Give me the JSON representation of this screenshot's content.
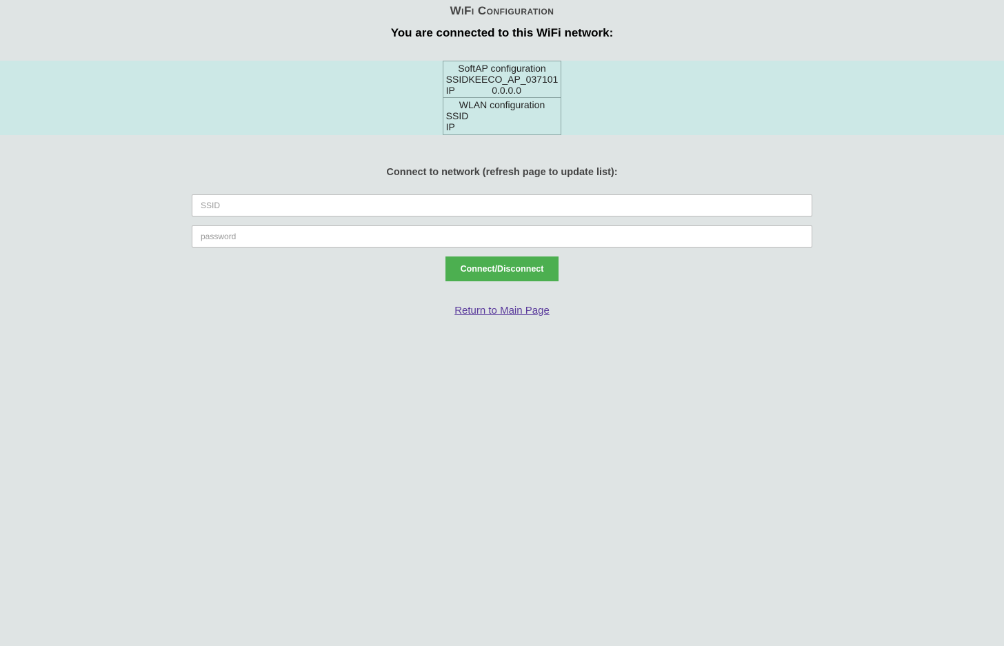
{
  "header": {
    "title": "WiFi Configuration",
    "connected_label": "You are connected to this WiFi network:"
  },
  "info": {
    "softap": {
      "title": "SoftAP configuration",
      "ssid_label": "SSID",
      "ssid_value": "KEECO_AP_037101",
      "ip_label": "IP",
      "ip_value": "0.0.0.0"
    },
    "wlan": {
      "title": "WLAN configuration",
      "ssid_label": "SSID",
      "ssid_value": "",
      "ip_label": "IP",
      "ip_value": ""
    }
  },
  "form": {
    "heading": "Connect to network (refresh page to update list):",
    "ssid_placeholder": "SSID",
    "ssid_value": "",
    "password_placeholder": "password",
    "password_value": "",
    "submit_label": "Connect/Disconnect"
  },
  "footer": {
    "return_link": "Return to Main Page"
  }
}
